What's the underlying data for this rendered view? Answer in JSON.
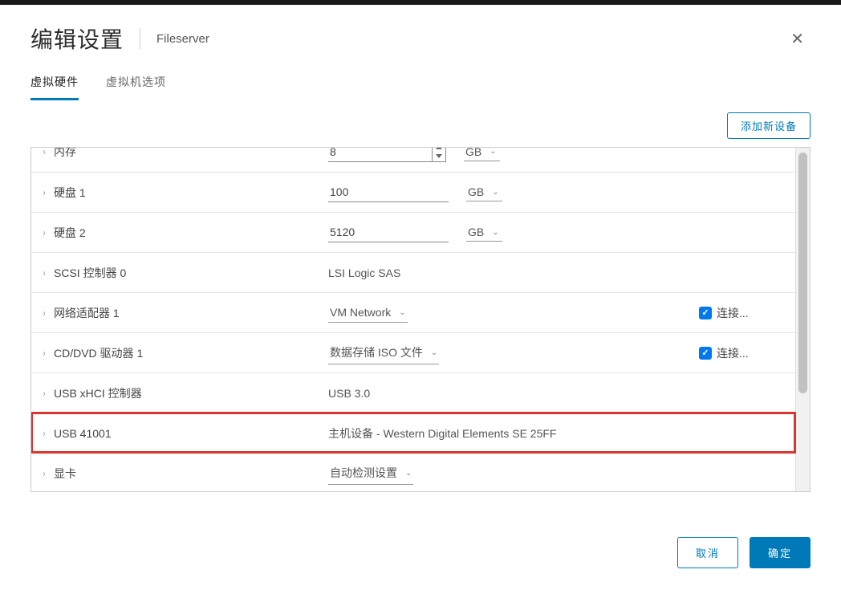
{
  "dialog": {
    "title": "编辑设置",
    "subtitle": "Fileserver"
  },
  "tabs": {
    "hardware": "虚拟硬件",
    "options": "虚拟机选项"
  },
  "actions": {
    "add_device": "添加新设备",
    "cancel": "取消",
    "ok": "确定"
  },
  "connect_label": "连接...",
  "rows": {
    "memory": {
      "label": "内存",
      "value": "8",
      "unit": "GB"
    },
    "disk1": {
      "label": "硬盘 1",
      "value": "100",
      "unit": "GB"
    },
    "disk2": {
      "label": "硬盘 2",
      "value": "5120",
      "unit": "GB"
    },
    "scsi": {
      "label": "SCSI 控制器 0",
      "value": "LSI Logic SAS"
    },
    "net": {
      "label": "网络适配器 1",
      "value": "VM Network",
      "connected": true
    },
    "cdrom": {
      "label": "CD/DVD 驱动器 1",
      "value": "数据存储 ISO 文件",
      "connected": true
    },
    "usb_c": {
      "label": "USB xHCI 控制器",
      "value": "USB 3.0"
    },
    "usb_dev": {
      "label": "USB 41001",
      "value": "主机设备 - Western Digital Elements SE 25FF"
    },
    "video": {
      "label": "显卡",
      "value": "自动检测设置"
    }
  }
}
